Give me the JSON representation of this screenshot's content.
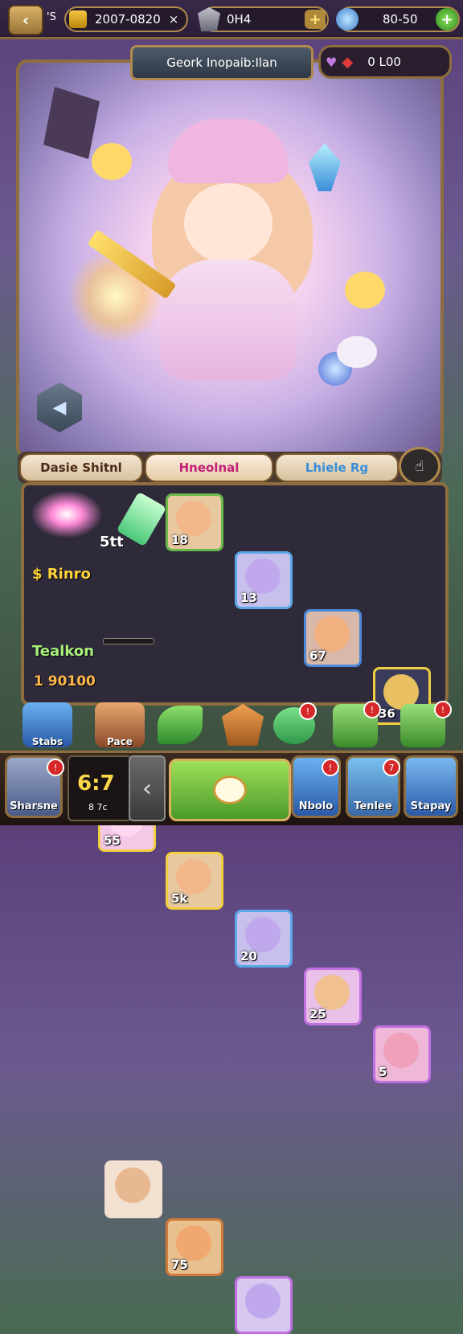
{
  "topbar": {
    "back_icon": "chevron-left-icon",
    "small_label": "'S",
    "gold_value": "2007-0820",
    "gold_close": "×",
    "gem_value": "0H4",
    "energy_value": "80-50",
    "plus": "+"
  },
  "scene": {
    "title": "Geork Inopaib:Ilan",
    "currency_value": "0 L00",
    "heart_icon": "heart-icon",
    "diamond_icon": "diamond-icon"
  },
  "tabs": [
    {
      "label": "Dasie Shitnl"
    },
    {
      "label": "Hneolnal"
    },
    {
      "label": "Lhiele Rg"
    }
  ],
  "panel": {
    "row1_label": "5tt",
    "row2_label": "$ Rinro",
    "row3_label": "Tealkon",
    "row3_value": "1 90100",
    "row1_cards": [
      "18",
      "13",
      "67",
      "36"
    ],
    "row2_cards": [
      "55",
      "5k",
      "20",
      "25",
      "5"
    ],
    "row3_cards": [
      "",
      "75",
      ""
    ]
  },
  "quickbar": [
    {
      "label": "Stabs",
      "icon": "crystal-icon"
    },
    {
      "label": "Pace",
      "icon": "pencil-icon"
    },
    {
      "label": "",
      "icon": "leaf-icon"
    },
    {
      "label": "",
      "icon": "gem-chest-icon"
    },
    {
      "label": "",
      "icon": "dragon-icon"
    },
    {
      "label": "",
      "icon": "box-icon"
    },
    {
      "label": "",
      "icon": "horn-icon"
    }
  ],
  "bottom": {
    "left_label": "Sharsne",
    "timer": "6:7",
    "timer_sub": "8 7c",
    "btn_a_label": "Nbolo",
    "btn_b_label": "Tenlee",
    "btn_c_label": "Stapay",
    "badge_a": "!",
    "badge_b": "7"
  }
}
